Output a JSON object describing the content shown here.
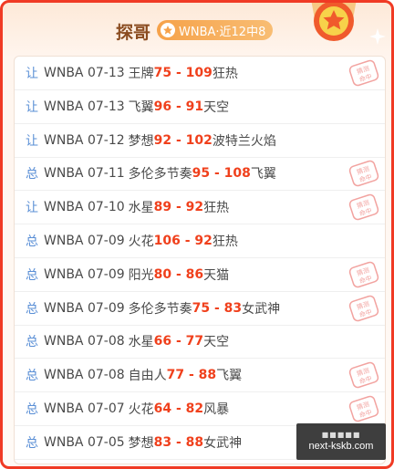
{
  "header": {
    "title": "探哥",
    "badge": "WNBA·近12中8",
    "badge_icon": "star-icon",
    "medal_icon": "star-medal-icon",
    "colors": {
      "border": "#f03a24",
      "score": "#f0401c",
      "tag": "#5a8fd6",
      "badge": "#f6a24a"
    }
  },
  "rows": [
    {
      "tag": "让",
      "date": "WNBA 07-13",
      "team_a": "王牌",
      "score": "75 - 109",
      "team_b": "狂热",
      "stamp": "猜测命中"
    },
    {
      "tag": "让",
      "date": "WNBA 07-13",
      "team_a": "飞翼",
      "score": "96 - 91",
      "team_b": "天空",
      "stamp": ""
    },
    {
      "tag": "让",
      "date": "WNBA 07-12",
      "team_a": "梦想",
      "score": "92 - 102",
      "team_b": "波特兰火焰",
      "stamp": ""
    },
    {
      "tag": "总",
      "date": "WNBA 07-11",
      "team_a": "多伦多节奏",
      "score": "95 - 108",
      "team_b": "飞翼",
      "stamp": "猜测命中"
    },
    {
      "tag": "让",
      "date": "WNBA 07-10",
      "team_a": "水星",
      "score": "89 - 92",
      "team_b": "狂热",
      "stamp": "猜测命中"
    },
    {
      "tag": "总",
      "date": "WNBA 07-09",
      "team_a": "火花",
      "score": "106 - 92",
      "team_b": "狂热",
      "stamp": ""
    },
    {
      "tag": "总",
      "date": "WNBA 07-09",
      "team_a": "阳光",
      "score": "80 - 86",
      "team_b": "天猫",
      "stamp": "猜测命中"
    },
    {
      "tag": "总",
      "date": "WNBA 07-09",
      "team_a": "多伦多节奏",
      "score": "75 - 83",
      "team_b": "女武神",
      "stamp": "猜测命中"
    },
    {
      "tag": "总",
      "date": "WNBA 07-08",
      "team_a": "水星",
      "score": "66 - 77",
      "team_b": "天空",
      "stamp": ""
    },
    {
      "tag": "总",
      "date": "WNBA 07-08",
      "team_a": "自由人",
      "score": "77 - 88",
      "team_b": "飞翼",
      "stamp": "猜测命中"
    },
    {
      "tag": "总",
      "date": "WNBA 07-07",
      "team_a": "火花",
      "score": "64 - 82",
      "team_b": "风暴",
      "stamp": "猜测命中"
    },
    {
      "tag": "总",
      "date": "WNBA 07-05",
      "team_a": "梦想",
      "score": "83 - 88",
      "team_b": "女武神",
      "stamp": ""
    }
  ],
  "watermark": {
    "dots": "■■■■■",
    "text": "next-kskb.com"
  }
}
